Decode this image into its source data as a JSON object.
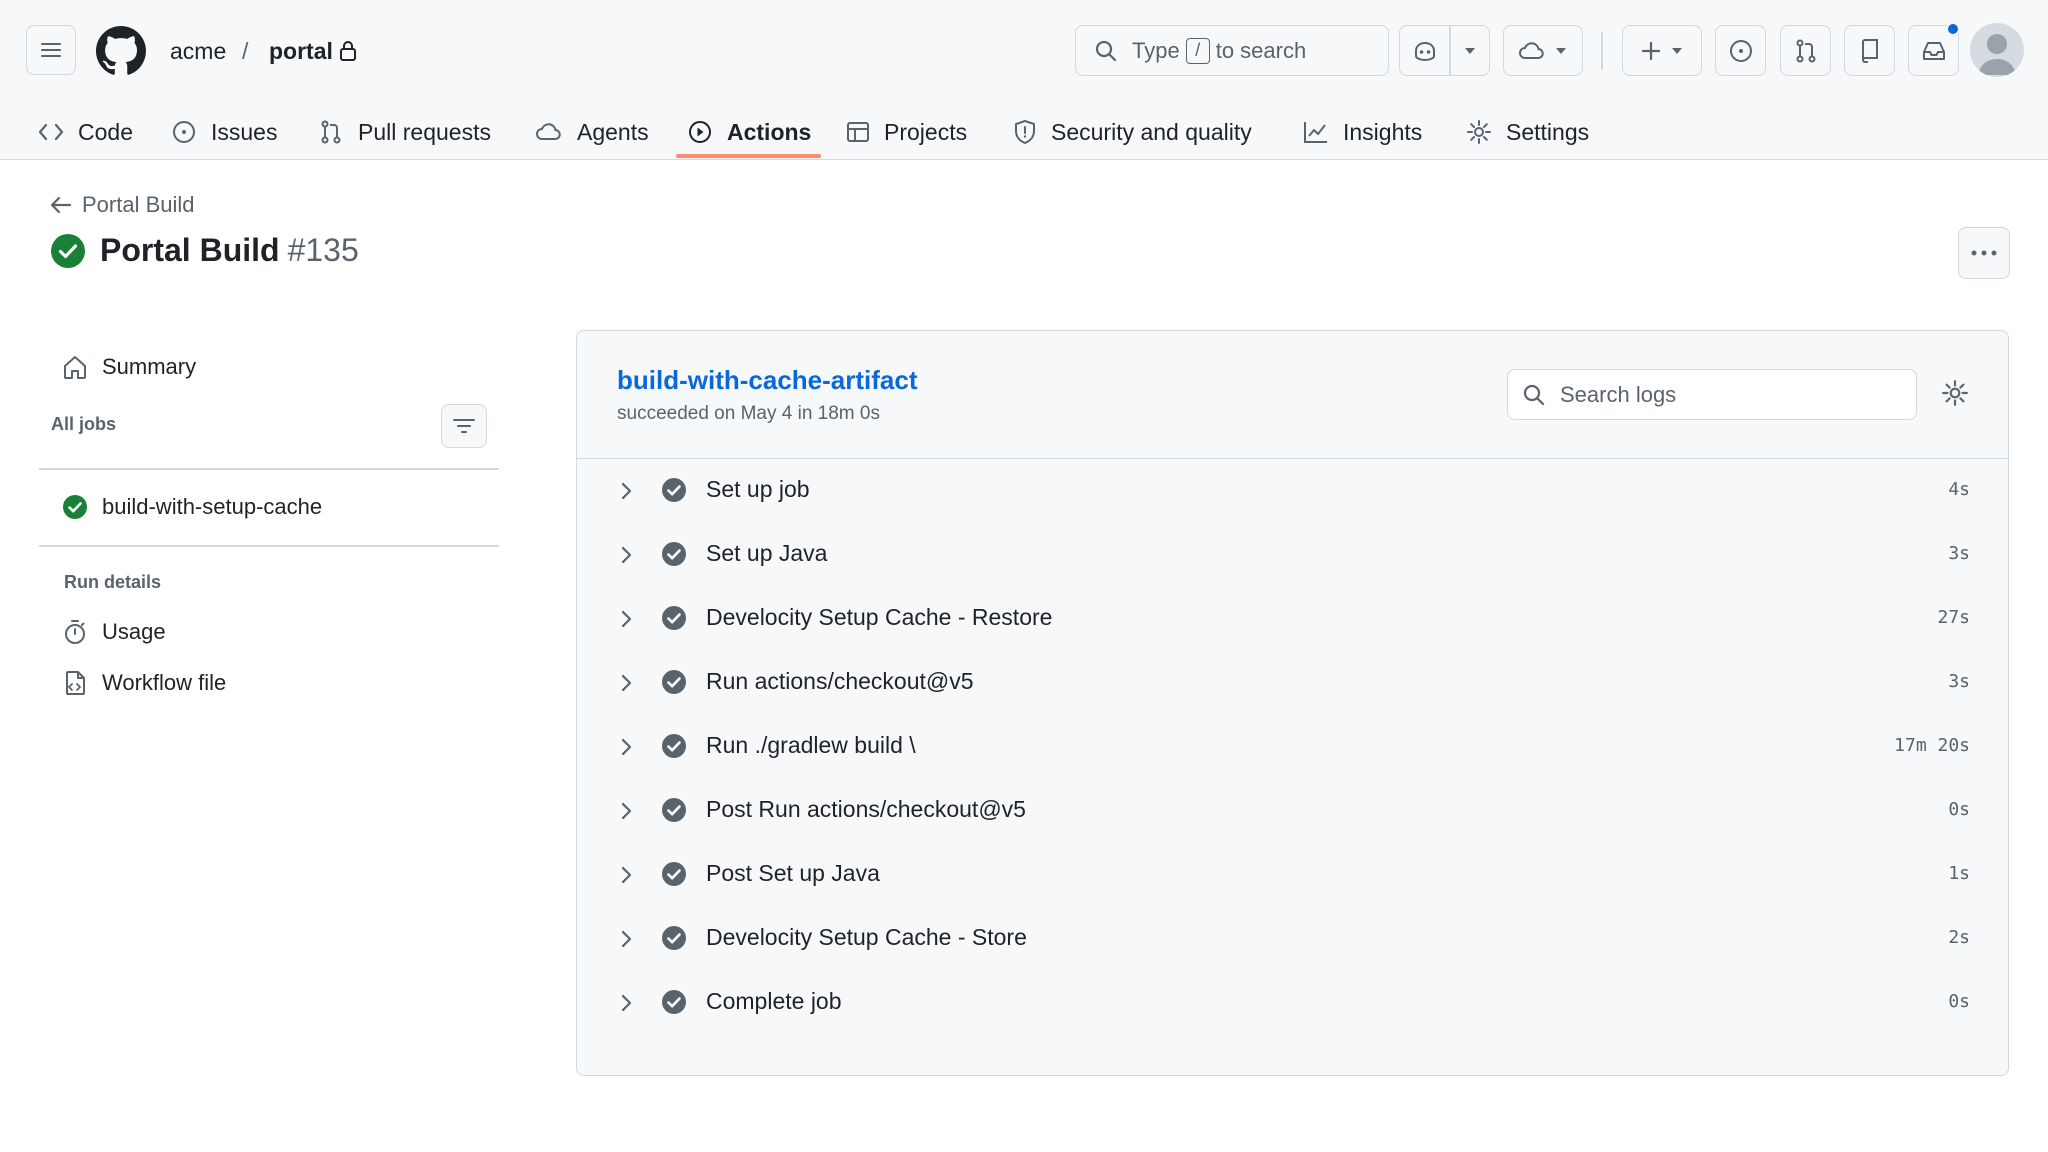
{
  "header": {
    "owner": "acme",
    "separator": "/",
    "repo": "portal",
    "search": {
      "before": "Type",
      "key": "/",
      "after": "to search"
    }
  },
  "tabs": [
    {
      "label": "Code",
      "icon": "code-icon",
      "active": false
    },
    {
      "label": "Issues",
      "icon": "issue-opened-icon",
      "active": false
    },
    {
      "label": "Pull requests",
      "icon": "git-pull-request-icon",
      "active": false
    },
    {
      "label": "Agents",
      "icon": "agent-icon",
      "active": false
    },
    {
      "label": "Actions",
      "icon": "play-icon",
      "active": true
    },
    {
      "label": "Projects",
      "icon": "table-icon",
      "active": false
    },
    {
      "label": "Security and quality",
      "icon": "shield-icon",
      "active": false
    },
    {
      "label": "Insights",
      "icon": "graph-icon",
      "active": false
    },
    {
      "label": "Settings",
      "icon": "gear-icon",
      "active": false
    }
  ],
  "run": {
    "back_label": "Portal Build",
    "title": "Portal Build",
    "number": "#135",
    "status": "success"
  },
  "sidebar": {
    "summary": "Summary",
    "all_jobs": "All jobs",
    "jobs": [
      {
        "name": "build-with-setup-cache",
        "status": "success"
      }
    ],
    "run_details": "Run details",
    "usage": "Usage",
    "workflow_file": "Workflow file"
  },
  "job": {
    "name": "build-with-cache-artifact",
    "meta": "succeeded on May 4 in 18m 0s",
    "search_placeholder": "Search logs",
    "steps": [
      {
        "name": "Set up job",
        "duration": "4s"
      },
      {
        "name": "Set up Java",
        "duration": "3s"
      },
      {
        "name": "Develocity Setup Cache - Restore",
        "duration": "27s"
      },
      {
        "name": "Run actions/checkout@v5",
        "duration": "3s"
      },
      {
        "name": "Run ./gradlew build \\",
        "duration": "17m 20s"
      },
      {
        "name": "Post Run actions/checkout@v5",
        "duration": "0s"
      },
      {
        "name": "Post Set up Java",
        "duration": "1s"
      },
      {
        "name": "Develocity Setup Cache - Store",
        "duration": "2s"
      },
      {
        "name": "Complete job",
        "duration": "0s"
      }
    ]
  },
  "colors": {
    "accent_blue": "#0969da",
    "success_green": "#1a7f37",
    "tab_underline": "#fd8c73",
    "step_icon": "#59636e"
  }
}
